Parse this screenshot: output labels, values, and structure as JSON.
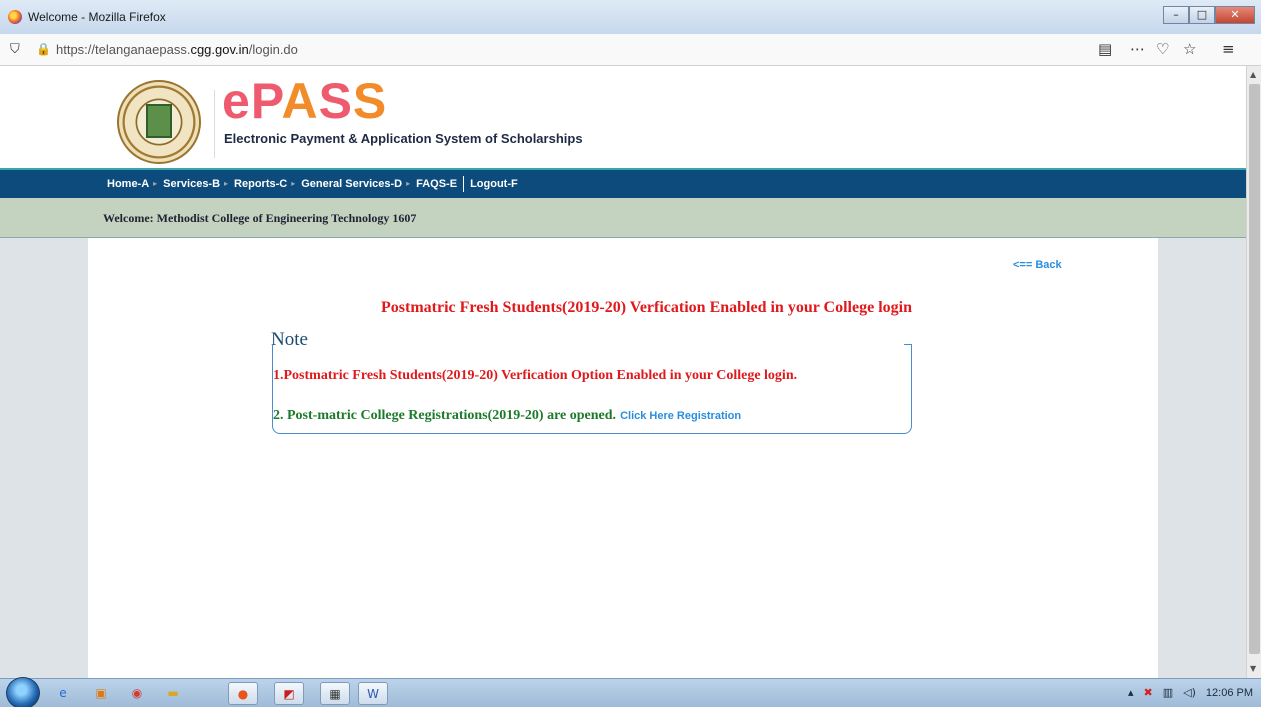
{
  "window": {
    "title": "Welcome - Mozilla Firefox",
    "minimize_glyph": "–",
    "maximize_glyph": "□",
    "close_glyph": "✕"
  },
  "addressbar": {
    "url_prefix": "https://telanganaepass.",
    "url_domain": "cgg.gov.in",
    "url_path": "/login.do",
    "icons": [
      "shield-icon",
      "lock-icon",
      "reader-view-icon",
      "more-icon",
      "pocket-icon",
      "bookmark-star-icon",
      "menu-icon"
    ]
  },
  "header": {
    "logo_letters": [
      "e",
      "P",
      "A",
      "S",
      "S"
    ],
    "tagline": "Electronic Payment & Application System of Scholarships"
  },
  "menu": {
    "items": [
      "Home-A",
      "Services-B",
      "Reports-C",
      "General Services-D",
      "FAQS-E",
      "Logout-F"
    ]
  },
  "welcome": {
    "text": "Welcome: Methodist College of Engineering Technology 1607"
  },
  "content": {
    "back_link": "<== Back",
    "headline": "Postmatric Fresh Students(2019-20) Verfication Enabled in your College login",
    "note_title": "Note",
    "line1": "1.Postmatric Fresh Students(2019-20) Verfication Option Enabled in your College login.",
    "line2": "2. Post-matric College Registrations(2019-20) are opened.",
    "registration_link": "Click Here Registration"
  },
  "taskbar": {
    "apps": [
      "ie-icon",
      "media-player-icon",
      "chrome-icon",
      "explorer-icon",
      "firefox-icon",
      "acrobat-icon",
      "app-icon",
      "word-icon"
    ],
    "clock": "12:06 PM"
  },
  "colors": {
    "menubar": "#0d4b7c",
    "welcome_band": "#c3d3c0",
    "headline_red": "#e0191c",
    "green_text": "#1d7a2a",
    "link_blue": "#2a8ee0"
  }
}
